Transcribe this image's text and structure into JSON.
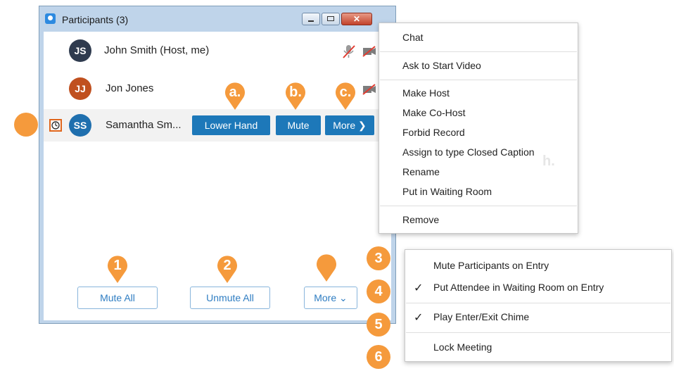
{
  "window": {
    "title": "Participants (3)",
    "close_glyph": "✕"
  },
  "participants": [
    {
      "initials": "JS",
      "name": "John Smith (Host, me)",
      "avatar_color": "#2f3b4f"
    },
    {
      "initials": "JJ",
      "name": "Jon Jones",
      "avatar_color": "#c0501f"
    },
    {
      "initials": "SS",
      "name": "Samantha Sm...",
      "avatar_color": "#1f6fae"
    }
  ],
  "row_actions": {
    "lower_hand": "Lower Hand",
    "mute": "Mute",
    "more": "More ❯"
  },
  "bottom_buttons": {
    "mute_all": "Mute All",
    "unmute_all": "Unmute All",
    "more": "More ⌄"
  },
  "participant_menu": {
    "items": [
      "Chat",
      "Ask to Start Video",
      "Make Host",
      "Make Co-Host",
      "Forbid Record",
      "Assign to type Closed Caption",
      "Rename",
      "Put in Waiting Room",
      "Remove"
    ]
  },
  "hidden_letter": "h.",
  "meeting_menu": {
    "items": [
      {
        "label": "Mute Participants on Entry",
        "check": ""
      },
      {
        "label": "Put Attendee in Waiting Room on Entry",
        "check": "✓"
      },
      {
        "label": "Play Enter/Exit Chime",
        "check": "✓"
      },
      {
        "label": "Lock Meeting",
        "check": ""
      }
    ]
  },
  "callouts": {
    "a": "a.",
    "b": "b.",
    "c": "c.",
    "n1": "1",
    "n2": "2",
    "n3": "3",
    "n4": "4",
    "n5": "5",
    "n6": "6"
  },
  "colors": {
    "accent": "#1d78b9",
    "callout": "#f59a3c"
  }
}
